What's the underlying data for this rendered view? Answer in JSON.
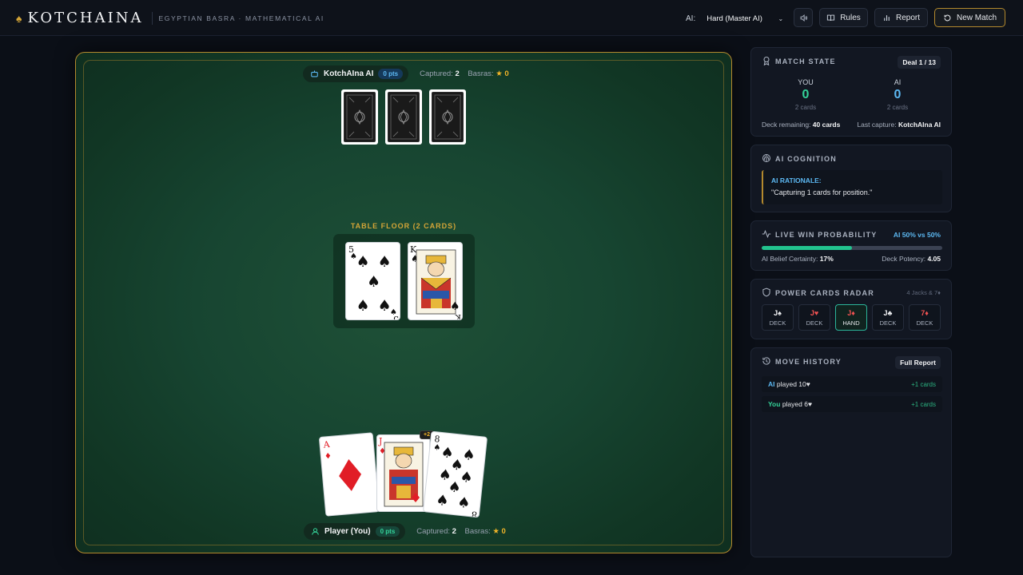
{
  "header": {
    "brand_symbol": "♠",
    "brand_title": "KOTCHAINA",
    "brand_subtitle": "EGYPTIAN BASRA · MATHEMATICAL AI",
    "ai_label": "AI:",
    "ai_level": "Hard (Master AI)",
    "rules_label": "Rules",
    "report_label": "Report",
    "new_match_label": "New Match"
  },
  "table": {
    "ai": {
      "name": "KotchAIna AI",
      "points": "0 pts",
      "captured_label": "Captured:",
      "captured_value": "2",
      "basras_label": "Basras:",
      "basras_star": "★",
      "basras_value": "0",
      "hand_count": 3
    },
    "floor_label": "TABLE FLOOR (2 CARDS)",
    "floor_cards": [
      {
        "rank": "5",
        "suit": "♠",
        "color": "#111111"
      },
      {
        "rank": "K",
        "suit": "♠",
        "color": "#111111"
      }
    ],
    "player": {
      "name": "Player (You)",
      "points": "0 pts",
      "captured_label": "Captured:",
      "captured_value": "2",
      "basras_label": "Basras:",
      "basras_star": "★",
      "basras_value": "0",
      "hand": [
        {
          "rank": "A",
          "suit": "♦",
          "color": "#e11d26"
        },
        {
          "rank": "J",
          "suit": "♦",
          "color": "#e11d26"
        },
        {
          "rank": "8",
          "suit": "♠",
          "color": "#111111"
        }
      ],
      "capture_hint": "+2"
    }
  },
  "match_state": {
    "title": "MATCH STATE",
    "deal": "Deal 1 / 13",
    "you_label": "YOU",
    "you_score": "0",
    "you_cards": "2 cards",
    "ai_label": "AI",
    "ai_score": "0",
    "ai_cards": "2 cards",
    "deck_label": "Deck remaining:",
    "deck_value": "40 cards",
    "last_capture_label": "Last capture:",
    "last_capture_value": "KotchAIna AI"
  },
  "ai_cognition": {
    "title": "AI COGNITION",
    "rationale_title": "AI RATIONALE:",
    "rationale_text": "\"Capturing 1 cards for position.\""
  },
  "win_probability": {
    "title": "LIVE WIN PROBABILITY",
    "summary": "AI 50% vs 50%",
    "ai_share": 0.5,
    "belief_label": "AI Belief Certainty:",
    "belief_value": "17%",
    "potency_label": "Deck Potency:",
    "potency_value": "4.05"
  },
  "power_cards": {
    "title": "POWER CARDS RADAR",
    "subtitle": "4 Jacks & 7♦",
    "cards": [
      {
        "label": "J♠",
        "location": "DECK",
        "color": "#f3f4f6"
      },
      {
        "label": "J♥",
        "location": "DECK",
        "color": "#f05252"
      },
      {
        "label": "J♦",
        "location": "HAND",
        "color": "#f05252"
      },
      {
        "label": "J♣",
        "location": "DECK",
        "color": "#f3f4f6"
      },
      {
        "label": "7♦",
        "location": "DECK",
        "color": "#f05252"
      }
    ]
  },
  "move_history": {
    "title": "MOVE HISTORY",
    "full_report_label": "Full Report",
    "moves": [
      {
        "who": "AI",
        "text": "played 10♥",
        "gain": "+1 cards"
      },
      {
        "who": "You",
        "text": "played 6♥",
        "gain": "+1 cards"
      }
    ]
  },
  "colors": {
    "gold": "#b3892d",
    "ai_blue": "#5cb8f2",
    "you_green": "#34d399",
    "felt": "#174531"
  }
}
